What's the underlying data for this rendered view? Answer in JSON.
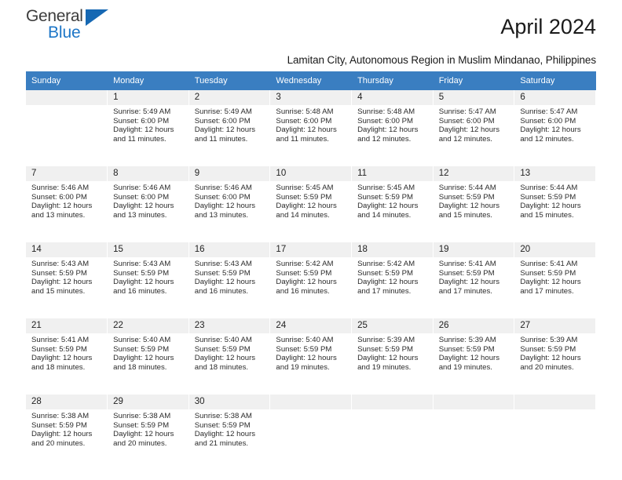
{
  "brand": {
    "name_top": "General",
    "name_bottom": "Blue",
    "triangle_color": "#1668b3",
    "blue_color": "#1d76c7"
  },
  "header": {
    "month_title": "April 2024",
    "subtitle": "Lamitan City, Autonomous Region in Muslim Mindanao, Philippines",
    "header_bg": "#3a7ec1",
    "daynum_bg": "#f0f0f0"
  },
  "weekday_headers": [
    "Sunday",
    "Monday",
    "Tuesday",
    "Wednesday",
    "Thursday",
    "Friday",
    "Saturday"
  ],
  "labels": {
    "sunrise_prefix": "Sunrise: ",
    "sunset_prefix": "Sunset: ",
    "daylight_prefix": "Daylight: "
  },
  "weeks": [
    [
      {
        "day": "",
        "sunrise": "",
        "sunset": "",
        "daylight_line1": "",
        "daylight_line2": ""
      },
      {
        "day": "1",
        "sunrise": "Sunrise: 5:49 AM",
        "sunset": "Sunset: 6:00 PM",
        "daylight_line1": "Daylight: 12 hours",
        "daylight_line2": "and 11 minutes."
      },
      {
        "day": "2",
        "sunrise": "Sunrise: 5:49 AM",
        "sunset": "Sunset: 6:00 PM",
        "daylight_line1": "Daylight: 12 hours",
        "daylight_line2": "and 11 minutes."
      },
      {
        "day": "3",
        "sunrise": "Sunrise: 5:48 AM",
        "sunset": "Sunset: 6:00 PM",
        "daylight_line1": "Daylight: 12 hours",
        "daylight_line2": "and 11 minutes."
      },
      {
        "day": "4",
        "sunrise": "Sunrise: 5:48 AM",
        "sunset": "Sunset: 6:00 PM",
        "daylight_line1": "Daylight: 12 hours",
        "daylight_line2": "and 12 minutes."
      },
      {
        "day": "5",
        "sunrise": "Sunrise: 5:47 AM",
        "sunset": "Sunset: 6:00 PM",
        "daylight_line1": "Daylight: 12 hours",
        "daylight_line2": "and 12 minutes."
      },
      {
        "day": "6",
        "sunrise": "Sunrise: 5:47 AM",
        "sunset": "Sunset: 6:00 PM",
        "daylight_line1": "Daylight: 12 hours",
        "daylight_line2": "and 12 minutes."
      }
    ],
    [
      {
        "day": "7",
        "sunrise": "Sunrise: 5:46 AM",
        "sunset": "Sunset: 6:00 PM",
        "daylight_line1": "Daylight: 12 hours",
        "daylight_line2": "and 13 minutes."
      },
      {
        "day": "8",
        "sunrise": "Sunrise: 5:46 AM",
        "sunset": "Sunset: 6:00 PM",
        "daylight_line1": "Daylight: 12 hours",
        "daylight_line2": "and 13 minutes."
      },
      {
        "day": "9",
        "sunrise": "Sunrise: 5:46 AM",
        "sunset": "Sunset: 6:00 PM",
        "daylight_line1": "Daylight: 12 hours",
        "daylight_line2": "and 13 minutes."
      },
      {
        "day": "10",
        "sunrise": "Sunrise: 5:45 AM",
        "sunset": "Sunset: 5:59 PM",
        "daylight_line1": "Daylight: 12 hours",
        "daylight_line2": "and 14 minutes."
      },
      {
        "day": "11",
        "sunrise": "Sunrise: 5:45 AM",
        "sunset": "Sunset: 5:59 PM",
        "daylight_line1": "Daylight: 12 hours",
        "daylight_line2": "and 14 minutes."
      },
      {
        "day": "12",
        "sunrise": "Sunrise: 5:44 AM",
        "sunset": "Sunset: 5:59 PM",
        "daylight_line1": "Daylight: 12 hours",
        "daylight_line2": "and 15 minutes."
      },
      {
        "day": "13",
        "sunrise": "Sunrise: 5:44 AM",
        "sunset": "Sunset: 5:59 PM",
        "daylight_line1": "Daylight: 12 hours",
        "daylight_line2": "and 15 minutes."
      }
    ],
    [
      {
        "day": "14",
        "sunrise": "Sunrise: 5:43 AM",
        "sunset": "Sunset: 5:59 PM",
        "daylight_line1": "Daylight: 12 hours",
        "daylight_line2": "and 15 minutes."
      },
      {
        "day": "15",
        "sunrise": "Sunrise: 5:43 AM",
        "sunset": "Sunset: 5:59 PM",
        "daylight_line1": "Daylight: 12 hours",
        "daylight_line2": "and 16 minutes."
      },
      {
        "day": "16",
        "sunrise": "Sunrise: 5:43 AM",
        "sunset": "Sunset: 5:59 PM",
        "daylight_line1": "Daylight: 12 hours",
        "daylight_line2": "and 16 minutes."
      },
      {
        "day": "17",
        "sunrise": "Sunrise: 5:42 AM",
        "sunset": "Sunset: 5:59 PM",
        "daylight_line1": "Daylight: 12 hours",
        "daylight_line2": "and 16 minutes."
      },
      {
        "day": "18",
        "sunrise": "Sunrise: 5:42 AM",
        "sunset": "Sunset: 5:59 PM",
        "daylight_line1": "Daylight: 12 hours",
        "daylight_line2": "and 17 minutes."
      },
      {
        "day": "19",
        "sunrise": "Sunrise: 5:41 AM",
        "sunset": "Sunset: 5:59 PM",
        "daylight_line1": "Daylight: 12 hours",
        "daylight_line2": "and 17 minutes."
      },
      {
        "day": "20",
        "sunrise": "Sunrise: 5:41 AM",
        "sunset": "Sunset: 5:59 PM",
        "daylight_line1": "Daylight: 12 hours",
        "daylight_line2": "and 17 minutes."
      }
    ],
    [
      {
        "day": "21",
        "sunrise": "Sunrise: 5:41 AM",
        "sunset": "Sunset: 5:59 PM",
        "daylight_line1": "Daylight: 12 hours",
        "daylight_line2": "and 18 minutes."
      },
      {
        "day": "22",
        "sunrise": "Sunrise: 5:40 AM",
        "sunset": "Sunset: 5:59 PM",
        "daylight_line1": "Daylight: 12 hours",
        "daylight_line2": "and 18 minutes."
      },
      {
        "day": "23",
        "sunrise": "Sunrise: 5:40 AM",
        "sunset": "Sunset: 5:59 PM",
        "daylight_line1": "Daylight: 12 hours",
        "daylight_line2": "and 18 minutes."
      },
      {
        "day": "24",
        "sunrise": "Sunrise: 5:40 AM",
        "sunset": "Sunset: 5:59 PM",
        "daylight_line1": "Daylight: 12 hours",
        "daylight_line2": "and 19 minutes."
      },
      {
        "day": "25",
        "sunrise": "Sunrise: 5:39 AM",
        "sunset": "Sunset: 5:59 PM",
        "daylight_line1": "Daylight: 12 hours",
        "daylight_line2": "and 19 minutes."
      },
      {
        "day": "26",
        "sunrise": "Sunrise: 5:39 AM",
        "sunset": "Sunset: 5:59 PM",
        "daylight_line1": "Daylight: 12 hours",
        "daylight_line2": "and 19 minutes."
      },
      {
        "day": "27",
        "sunrise": "Sunrise: 5:39 AM",
        "sunset": "Sunset: 5:59 PM",
        "daylight_line1": "Daylight: 12 hours",
        "daylight_line2": "and 20 minutes."
      }
    ],
    [
      {
        "day": "28",
        "sunrise": "Sunrise: 5:38 AM",
        "sunset": "Sunset: 5:59 PM",
        "daylight_line1": "Daylight: 12 hours",
        "daylight_line2": "and 20 minutes."
      },
      {
        "day": "29",
        "sunrise": "Sunrise: 5:38 AM",
        "sunset": "Sunset: 5:59 PM",
        "daylight_line1": "Daylight: 12 hours",
        "daylight_line2": "and 20 minutes."
      },
      {
        "day": "30",
        "sunrise": "Sunrise: 5:38 AM",
        "sunset": "Sunset: 5:59 PM",
        "daylight_line1": "Daylight: 12 hours",
        "daylight_line2": "and 21 minutes."
      },
      {
        "day": "",
        "sunrise": "",
        "sunset": "",
        "daylight_line1": "",
        "daylight_line2": ""
      },
      {
        "day": "",
        "sunrise": "",
        "sunset": "",
        "daylight_line1": "",
        "daylight_line2": ""
      },
      {
        "day": "",
        "sunrise": "",
        "sunset": "",
        "daylight_line1": "",
        "daylight_line2": ""
      },
      {
        "day": "",
        "sunrise": "",
        "sunset": "",
        "daylight_line1": "",
        "daylight_line2": ""
      }
    ]
  ]
}
